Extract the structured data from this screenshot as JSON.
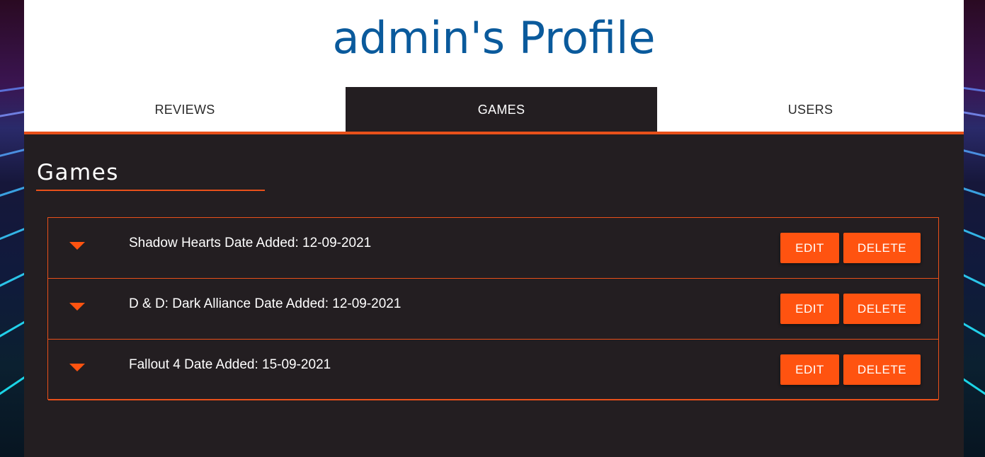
{
  "header": {
    "title": "admin's Profile"
  },
  "tabs": [
    {
      "label": "REVIEWS",
      "active": false
    },
    {
      "label": "GAMES",
      "active": true
    },
    {
      "label": "USERS",
      "active": false
    }
  ],
  "section": {
    "heading": "Games"
  },
  "games": [
    {
      "text": "Shadow Hearts Date Added: 12-09-2021",
      "edit_label": "EDIT",
      "delete_label": "DELETE"
    },
    {
      "text": "D & D: Dark Alliance Date Added: 12-09-2021",
      "edit_label": "EDIT",
      "delete_label": "DELETE"
    },
    {
      "text": "Fallout 4 Date Added: 15-09-2021",
      "edit_label": "EDIT",
      "delete_label": "DELETE"
    }
  ],
  "colors": {
    "accent": "#ff5310",
    "title_blue": "#0a5a9c",
    "panel_dark": "#231e21",
    "header_white": "#ffffff"
  },
  "icons": {
    "expand": "caret-down-icon"
  }
}
